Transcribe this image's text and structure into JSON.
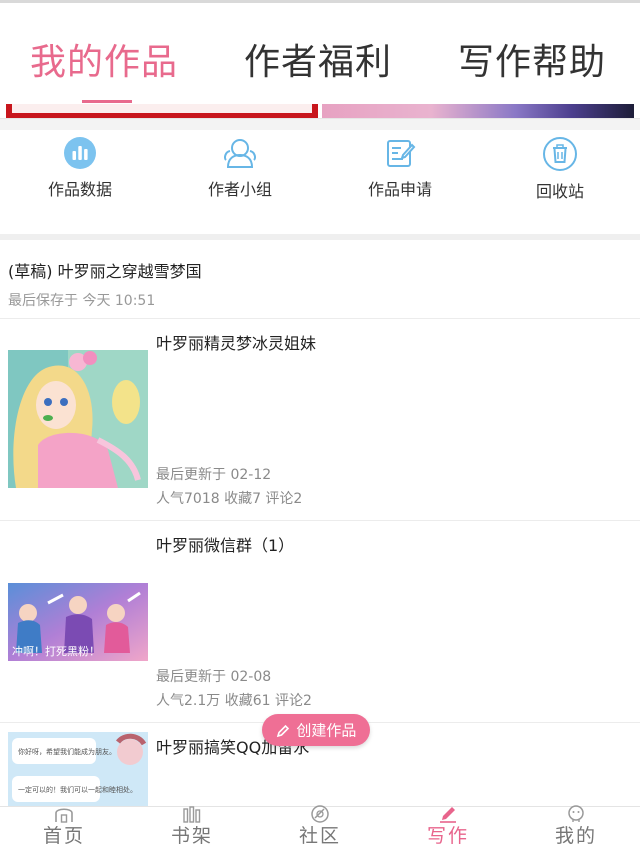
{
  "tabs": {
    "items": [
      {
        "label": "我的作品",
        "active": true
      },
      {
        "label": "作者福利",
        "active": false
      },
      {
        "label": "写作帮助",
        "active": false
      }
    ]
  },
  "tools": [
    {
      "label": "作品数据",
      "icon": "bar-chart-icon"
    },
    {
      "label": "作者小组",
      "icon": "group-icon"
    },
    {
      "label": "作品申请",
      "icon": "edit-document-icon"
    },
    {
      "label": "回收站",
      "icon": "trash-icon"
    }
  ],
  "draft": {
    "title": "(草稿) 叶罗丽之穿越雪梦国",
    "saved": "最后保存于 今天 10:51"
  },
  "works": [
    {
      "title": "叶罗丽精灵梦冰灵姐妹",
      "updated": "最后更新于 02-12",
      "stats": "人气7018 收藏7 评论2"
    },
    {
      "title": "叶罗丽微信群（1）",
      "updated": "最后更新于 02-08",
      "stats": "人气2.1万 收藏61 评论2",
      "cover_text": "冲啊！打死黑粉！"
    },
    {
      "title": "叶罗丽搞笑QQ加留水",
      "cover_text_1": "你好呀，希望我们能成为朋友。",
      "cover_text_2": "一定可以的！我们可以一起和睦相处。"
    }
  ],
  "create_button": {
    "label": "创建作品"
  },
  "bottom_nav": [
    {
      "label": "首页",
      "icon": "home-icon",
      "active": false
    },
    {
      "label": "书架",
      "icon": "bookshelf-icon",
      "active": false
    },
    {
      "label": "社区",
      "icon": "community-icon",
      "active": false
    },
    {
      "label": "写作",
      "icon": "pen-icon",
      "active": true
    },
    {
      "label": "我的",
      "icon": "profile-icon",
      "active": false
    }
  ],
  "colors": {
    "accent": "#e86a8d",
    "tool_icon": "#67b6e6",
    "text": "#222222",
    "muted": "#999999"
  }
}
